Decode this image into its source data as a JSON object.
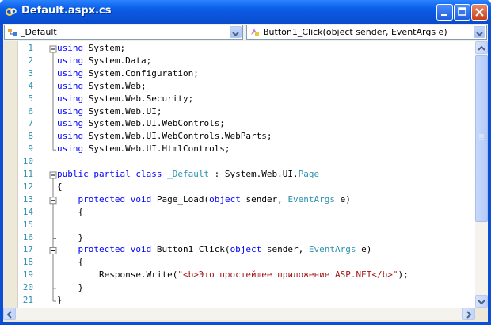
{
  "window": {
    "title": "Default.aspx.cs"
  },
  "nav": {
    "class_combo": "_Default",
    "member_combo": "Button1_Click(object sender, EventArgs e)"
  },
  "code": {
    "lines": [
      {
        "n": "1",
        "tokens": [
          {
            "t": "kw",
            "v": "using"
          },
          {
            "t": "",
            "v": " System;"
          }
        ]
      },
      {
        "n": "2",
        "tokens": [
          {
            "t": "kw",
            "v": "using"
          },
          {
            "t": "",
            "v": " System.Data;"
          }
        ]
      },
      {
        "n": "3",
        "tokens": [
          {
            "t": "kw",
            "v": "using"
          },
          {
            "t": "",
            "v": " System.Configuration;"
          }
        ]
      },
      {
        "n": "4",
        "tokens": [
          {
            "t": "kw",
            "v": "using"
          },
          {
            "t": "",
            "v": " System.Web;"
          }
        ]
      },
      {
        "n": "5",
        "tokens": [
          {
            "t": "kw",
            "v": "using"
          },
          {
            "t": "",
            "v": " System.Web.Security;"
          }
        ]
      },
      {
        "n": "6",
        "tokens": [
          {
            "t": "kw",
            "v": "using"
          },
          {
            "t": "",
            "v": " System.Web.UI;"
          }
        ]
      },
      {
        "n": "7",
        "tokens": [
          {
            "t": "kw",
            "v": "using"
          },
          {
            "t": "",
            "v": " System.Web.UI.WebControls;"
          }
        ]
      },
      {
        "n": "8",
        "tokens": [
          {
            "t": "kw",
            "v": "using"
          },
          {
            "t": "",
            "v": " System.Web.UI.WebControls.WebParts;"
          }
        ]
      },
      {
        "n": "9",
        "tokens": [
          {
            "t": "kw",
            "v": "using"
          },
          {
            "t": "",
            "v": " System.Web.UI.HtmlControls;"
          }
        ]
      },
      {
        "n": "10",
        "tokens": []
      },
      {
        "n": "11",
        "tokens": [
          {
            "t": "kw",
            "v": "public partial class"
          },
          {
            "t": "",
            "v": " "
          },
          {
            "t": "ty",
            "v": "_Default"
          },
          {
            "t": "",
            "v": " : System.Web.UI."
          },
          {
            "t": "ty",
            "v": "Page"
          }
        ]
      },
      {
        "n": "12",
        "tokens": [
          {
            "t": "",
            "v": "{"
          }
        ]
      },
      {
        "n": "13",
        "tokens": [
          {
            "t": "",
            "v": "    "
          },
          {
            "t": "kw",
            "v": "protected void"
          },
          {
            "t": "",
            "v": " Page_Load("
          },
          {
            "t": "kw",
            "v": "object"
          },
          {
            "t": "",
            "v": " sender, "
          },
          {
            "t": "ty",
            "v": "EventArgs"
          },
          {
            "t": "",
            "v": " e)"
          }
        ]
      },
      {
        "n": "14",
        "tokens": [
          {
            "t": "",
            "v": "    {"
          }
        ]
      },
      {
        "n": "15",
        "tokens": []
      },
      {
        "n": "16",
        "tokens": [
          {
            "t": "",
            "v": "    }"
          }
        ]
      },
      {
        "n": "17",
        "tokens": [
          {
            "t": "",
            "v": "    "
          },
          {
            "t": "kw",
            "v": "protected void"
          },
          {
            "t": "",
            "v": " Button1_Click("
          },
          {
            "t": "kw",
            "v": "object"
          },
          {
            "t": "",
            "v": " sender, "
          },
          {
            "t": "ty",
            "v": "EventArgs"
          },
          {
            "t": "",
            "v": " e)"
          }
        ]
      },
      {
        "n": "18",
        "tokens": [
          {
            "t": "",
            "v": "    {"
          }
        ]
      },
      {
        "n": "19",
        "tokens": [
          {
            "t": "",
            "v": "        Response.Write("
          },
          {
            "t": "st",
            "v": "\"<b>Это простейшее приложение ASP.NET</b>\""
          },
          {
            "t": "",
            "v": ");"
          }
        ]
      },
      {
        "n": "20",
        "tokens": [
          {
            "t": "",
            "v": "    }"
          }
        ]
      },
      {
        "n": "21",
        "tokens": [
          {
            "t": "",
            "v": "}"
          }
        ]
      }
    ]
  },
  "colors": {
    "keyword": "#0000ff",
    "type": "#2b91af",
    "string": "#a31515",
    "line_number": "#2b91af"
  }
}
